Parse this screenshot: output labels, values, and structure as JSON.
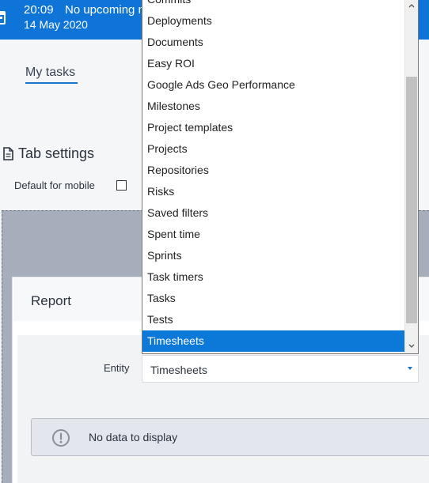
{
  "topbar": {
    "time": "20:09",
    "upcoming": "No upcoming m",
    "date": "14 May 2020"
  },
  "nav": {
    "my_tasks": "My tasks"
  },
  "tab_settings": {
    "title": "Tab settings",
    "default_for_mobile": "Default for mobile",
    "default_for_mobile_checked": false
  },
  "report": {
    "title": "Report",
    "entity_label": "Entity",
    "entity_value": "Timesheets",
    "no_data": "No data to display"
  },
  "dropdown": {
    "items": [
      "Commits",
      "Deployments",
      "Documents",
      "Easy ROI",
      "Google Ads Geo Performance",
      "Milestones",
      "Project templates",
      "Projects",
      "Repositories",
      "Risks",
      "Saved filters",
      "Spent time",
      "Sprints",
      "Task timers",
      "Tasks",
      "Tests",
      "Timesheets"
    ],
    "selected": "Timesheets"
  },
  "colors": {
    "topbar": "#0f74d7",
    "selected_item": "#0c78d7",
    "accent": "#1a73c8"
  }
}
